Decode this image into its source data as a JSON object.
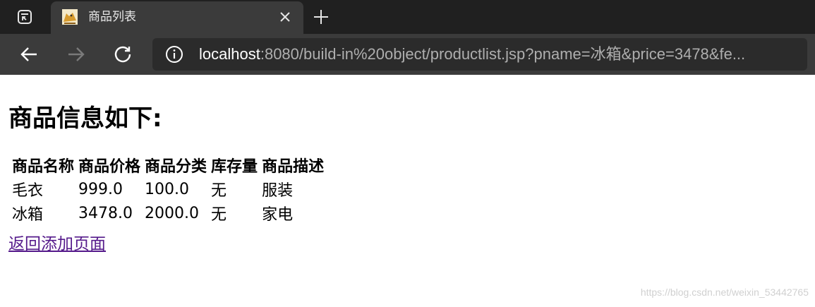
{
  "browser": {
    "tab": {
      "title": "商品列表"
    },
    "address_bar": {
      "url_host": "localhost",
      "url_rest": ":8080/build-in%20object/productlist.jsp?pname=冰箱&price=3478&fe..."
    }
  },
  "page": {
    "heading": "商品信息如下:",
    "table": {
      "headers": [
        "商品名称",
        "商品价格",
        "商品分类",
        "库存量",
        "商品描述"
      ],
      "rows": [
        [
          "毛衣",
          "999.0",
          "100.0",
          "无",
          "服装"
        ],
        [
          "冰箱",
          "3478.0",
          "2000.0",
          "无",
          "家电"
        ]
      ]
    },
    "back_link": "返回添加页面",
    "watermark": "https://blog.csdn.net/weixin_53442765"
  },
  "colors": {
    "tabbar_bg": "#202020",
    "toolbar_bg": "#3b3b3b",
    "visited_link": "#551a8b"
  }
}
